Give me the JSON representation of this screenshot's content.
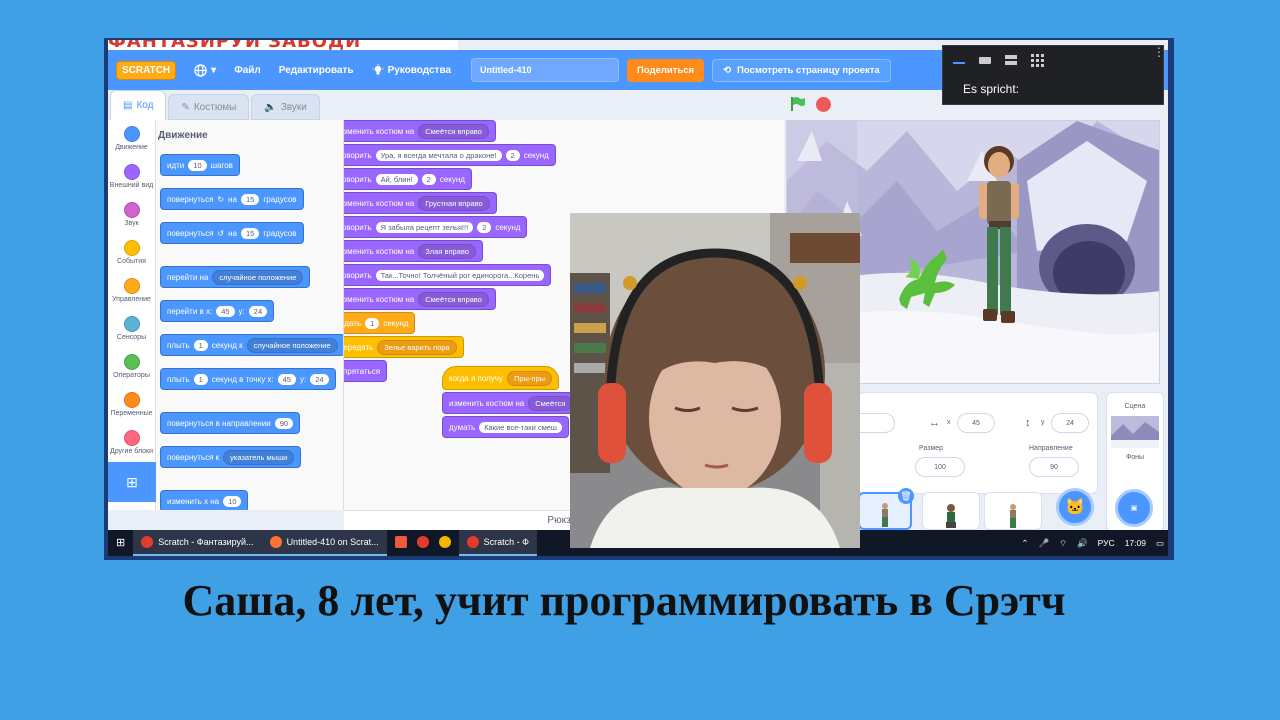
{
  "caption": "Саша, 8 лет, учит программировать в Срэтч",
  "banner_text": "ФАНТАЗИРУЙ ЗАВОДИ",
  "menubar": {
    "logo": "SCRATCH",
    "file": "Файл",
    "edit": "Редактировать",
    "tutorials": "Руководства",
    "project_title": "Untitled-410",
    "share": "Поделиться",
    "see_project": "Посмотреть страницу проекта"
  },
  "tabs": {
    "code": "Код",
    "costumes": "Костюмы",
    "sounds": "Звуки"
  },
  "categories": [
    {
      "label": "Движение",
      "color": "#4c97ff"
    },
    {
      "label": "Внешний вид",
      "color": "#9966ff"
    },
    {
      "label": "Звук",
      "color": "#cf63cf"
    },
    {
      "label": "События",
      "color": "#ffbf00"
    },
    {
      "label": "Управление",
      "color": "#ffab19"
    },
    {
      "label": "Сенсоры",
      "color": "#5cb1d6"
    },
    {
      "label": "Операторы",
      "color": "#59c059"
    },
    {
      "label": "Переменные",
      "color": "#ff8c1a"
    },
    {
      "label": "Другие блоки",
      "color": "#ff6680"
    }
  ],
  "palette": {
    "title": "Движение",
    "move": {
      "a": "идти",
      "n": "10",
      "b": "шагов"
    },
    "turn_right": {
      "a": "повернуться",
      "n": "15",
      "b": "градусов",
      "mid": "на"
    },
    "turn_left": {
      "a": "повернуться",
      "n": "15",
      "b": "градусов",
      "mid": "на"
    },
    "goto": {
      "a": "перейти на",
      "dd": "случайное положение"
    },
    "goto_xy": {
      "a": "перейти в x:",
      "x": "45",
      "ylabel": "y:",
      "y": "24"
    },
    "glide": {
      "a": "плыть",
      "n": "1",
      "b": "секунд к",
      "dd": "случайное положение"
    },
    "glide_xy": {
      "a": "плыть",
      "n": "1",
      "b": "секунд в точку x:",
      "x": "45",
      "ylabel": "y:",
      "y": "24"
    },
    "point_dir": {
      "a": "повернуться в направлении",
      "n": "90"
    },
    "point_to": {
      "a": "повернуться к",
      "dd": "указатель мыши"
    },
    "change_x": {
      "a": "изменить x на",
      "n": "10"
    }
  },
  "scripts": {
    "s1": {
      "a": "изменить костюм на",
      "dd": "Смеётся вправо"
    },
    "s2": {
      "a": "говорить",
      "t": "Ура, я всегда мечтала о драконе!",
      "n": "2",
      "b": "секунд"
    },
    "s3": {
      "a": "говорить",
      "t": "Ай, блин!",
      "n": "2",
      "b": "секунд"
    },
    "s4": {
      "a": "изменить костюм на",
      "dd": "Грустная вправо"
    },
    "s5": {
      "a": "говорить",
      "t": "Я забыла рецепт зелья!!!",
      "n": "2",
      "b": "секунд"
    },
    "s6": {
      "a": "изменить костюм на",
      "dd": "Злая вправо"
    },
    "s7": {
      "a": "говорить",
      "t": "Так...Точно! Толчёный рог единорога...Корень"
    },
    "s8": {
      "a": "изменить костюм на",
      "dd": "Смеётся вправо"
    },
    "s9": {
      "a": "ждать",
      "n": "1",
      "b": "секунд"
    },
    "s10": {
      "a": "передать",
      "dd": "Зелье варить пора"
    },
    "s11": {
      "a": "спрятаться"
    },
    "h1": {
      "a": "когда я получу",
      "dd": "Пры-пры"
    },
    "h2": {
      "a": "изменить костюм на",
      "dd": "Смеётся"
    },
    "h3": {
      "a": "думать",
      "t": "Какие все-таки смеш"
    },
    "backpack": "Рюкзак"
  },
  "sprite_info": {
    "x": "45",
    "y": "24",
    "size_label": "Размер",
    "size": "100",
    "direction_label": "Направление",
    "direction": "90"
  },
  "scene": {
    "label": "Сцена",
    "backdrops": "Фоны"
  },
  "taskbar": {
    "items": [
      {
        "label": "Scratch - Фантазируй...",
        "icon_color": "#e23b2e"
      },
      {
        "label": "Untitled-410 on Scrat...",
        "icon_color": "#ff7139"
      },
      {
        "label": "Scratch - Ф",
        "icon_color": "#e23b2e"
      }
    ],
    "lang": "РУС",
    "time": "17:09"
  },
  "call": {
    "speaking": "Es spricht:"
  }
}
